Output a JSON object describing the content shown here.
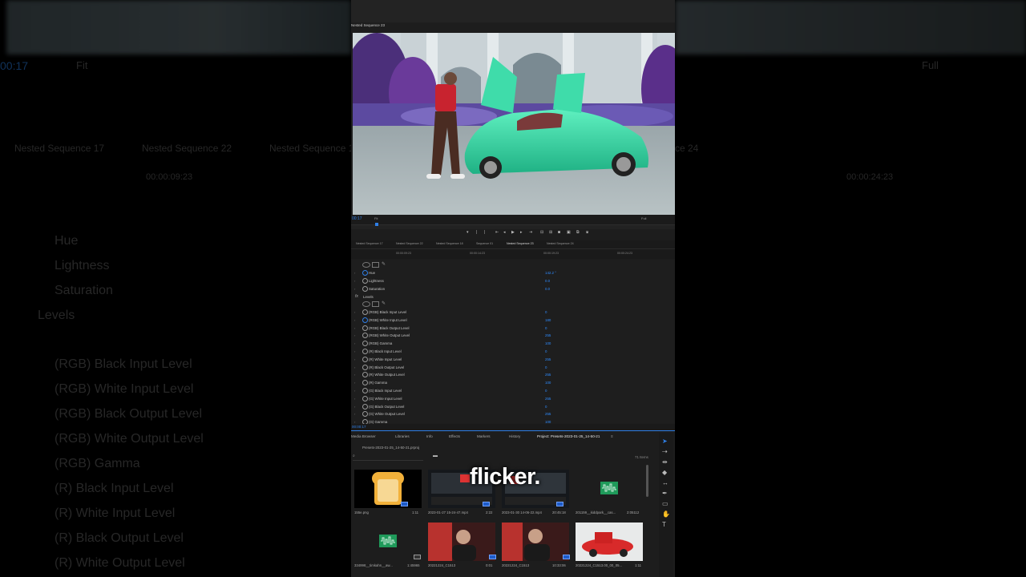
{
  "background": {
    "timecode": "00:17",
    "fit_label": "Fit",
    "full_label": "Full",
    "seq_tabs": [
      "Nested Sequence 17",
      "Nested Sequence 22",
      "Nested Sequence 18",
      "ce 24"
    ],
    "time_left": "00:00:09:23",
    "time_right": "00:00:24:23",
    "props": [
      "Hue",
      "Lightness",
      "Saturation"
    ],
    "fx_levels": "Levels",
    "levels": [
      "(RGB) Black Input Level",
      "(RGB) White Input Level",
      "(RGB) Black Output Level",
      "(RGB) White Output Level",
      "(RGB) Gamma",
      "(R) Black Input Level",
      "(R) White Input Level",
      "(R) Black Output Level",
      "(R) White Output Level"
    ]
  },
  "panel": {
    "sequence_tab": "Nested Sequence 23",
    "monitor": {
      "timecode": "00:17",
      "fit": "Fit",
      "quality": "Full"
    },
    "sequence_tabs": [
      {
        "label": "Nested Sequence 17",
        "active": false
      },
      {
        "label": "Nested Sequence 22",
        "active": false
      },
      {
        "label": "Nested Sequence 18",
        "active": false
      },
      {
        "label": "Sequence 01",
        "active": false
      },
      {
        "label": "Nested Sequence 23",
        "active": true
      },
      {
        "label": "Nested Sequence 24",
        "active": false
      }
    ],
    "ruler_times": [
      "00:00:09:23",
      "00:00:14:23",
      "00:00:19:23",
      "00:00:24:23"
    ],
    "effects": {
      "color_props": [
        {
          "label": "Hue",
          "value": "142.2 °"
        },
        {
          "label": "Lightness",
          "value": "0.0"
        },
        {
          "label": "Saturation",
          "value": "0.0"
        }
      ],
      "fx_name": "Levels",
      "fx_symbol": "fx",
      "level_props": [
        {
          "label": "(RGB) Black Input Level",
          "value": "0"
        },
        {
          "label": "(RGB) White Input Level",
          "value": "180"
        },
        {
          "label": "(RGB) Black Output Level",
          "value": "0"
        },
        {
          "label": "(RGB) White Output Level",
          "value": "255"
        },
        {
          "label": "(RGB) Gamma",
          "value": "100"
        },
        {
          "label": "(R) Black Input Level",
          "value": "0"
        },
        {
          "label": "(R) White Input Level",
          "value": "255"
        },
        {
          "label": "(R) Black Output Level",
          "value": "0"
        },
        {
          "label": "(R) White Output Level",
          "value": "255"
        },
        {
          "label": "(R) Gamma",
          "value": "100"
        },
        {
          "label": "(G) Black Input Level",
          "value": "0"
        },
        {
          "label": "(G) White Input Level",
          "value": "255"
        },
        {
          "label": "(G) Black Output Level",
          "value": "0"
        },
        {
          "label": "(G) White Output Level",
          "value": "255"
        },
        {
          "label": "(G) Gamma",
          "value": "100"
        }
      ]
    },
    "current_timecode": "00:00:17",
    "project_tabs": [
      {
        "label": "Media Browser",
        "active": false
      },
      {
        "label": "Libraries",
        "active": false
      },
      {
        "label": "Info",
        "active": false
      },
      {
        "label": "Effects",
        "active": false
      },
      {
        "label": "Markers",
        "active": false
      },
      {
        "label": "History",
        "active": false
      },
      {
        "label": "Project: Presets-2023-01-25_14-50-21",
        "active": true
      }
    ],
    "project_menu": "≡",
    "project_path": "Presets-2023-01-25_14-50-21.prproj",
    "items_count": "71 Items",
    "assets": [
      {
        "name": "155e.png",
        "duration": "1:11"
      },
      {
        "name": "2023-01-27 15-24-47.mp4",
        "duration": "2:22"
      },
      {
        "name": "2023-01-30 14-06-22.mp4",
        "duration": "20:45:18"
      },
      {
        "name": "201159__kiddpark__cas...",
        "duration": "2:05112"
      },
      {
        "name": "334998__timkahn__aw...",
        "duration": "1:45965"
      },
      {
        "name": "20221224_C1513",
        "duration": "0:01"
      },
      {
        "name": "20221224_C1513",
        "duration": "10:33:06"
      },
      {
        "name": "20221224_C1513.00_00_05...",
        "duration": "1:11"
      }
    ]
  },
  "caption": "flicker.",
  "colors": {
    "accent_blue": "#2f7fe6",
    "car_green": "#35d6a0",
    "panel_bg": "#1d1d1d"
  }
}
